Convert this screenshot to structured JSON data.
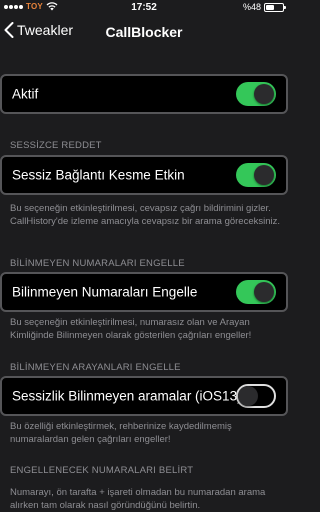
{
  "status_bar": {
    "carrier": "TOY",
    "time": "17:52",
    "battery_text": "%48",
    "battery_level": 0.48
  },
  "nav": {
    "back_label": "Tweakler",
    "title": "CallBlocker"
  },
  "rows": {
    "aktif": {
      "label": "Aktif",
      "on": true
    },
    "silent": {
      "label": "Sessiz Bağlantı Kesme Etkin",
      "on": true
    },
    "unknown": {
      "label": "Bilinmeyen Numaraları Engelle",
      "on": true
    },
    "silence_unknown": {
      "label": "Sessizlik Bilinmeyen aramalar (iOS13)",
      "on": false
    }
  },
  "sections": {
    "silent_header": "SESSİZCE REDDET",
    "silent_footer": "Bu seçeneğin etkinleştirilmesi, cevapsız çağrı bildirimini gizler. CallHistory'de izleme amacıyla cevapsız bir arama göreceksiniz.",
    "unknown_header": "BİLİNMEYEN NUMARALARI ENGELLE",
    "unknown_footer": "Bu seçeneğin etkinleştirilmesi, numarasız olan ve Arayan Kimliğinde Bilinmeyen olarak gösterilen çağrıları engeller!",
    "callers_header": "BİLİNMEYEN ARAYANLARI ENGELLE",
    "callers_footer": "Bu özelliği etkinleştirmek, rehberinize kaydedilmemiş numaralardan gelen çağrıları engeller!",
    "specify_header": "ENGELLENECEK NUMARALARI BELİRT",
    "specify_footer": "Numarayı, ön tarafta + işareti olmadan bu numaradan arama alırken tam olarak nasıl göründüğünü belirtin."
  },
  "colors": {
    "switch_on": "#34c759",
    "background": "#1c1c1e",
    "row_background": "#000000",
    "secondary_text": "#8e8e93",
    "carrier": "#e8833a"
  },
  "icons": {
    "back": "chevron-left-icon",
    "wifi": "wifi-icon",
    "battery": "battery-icon"
  }
}
